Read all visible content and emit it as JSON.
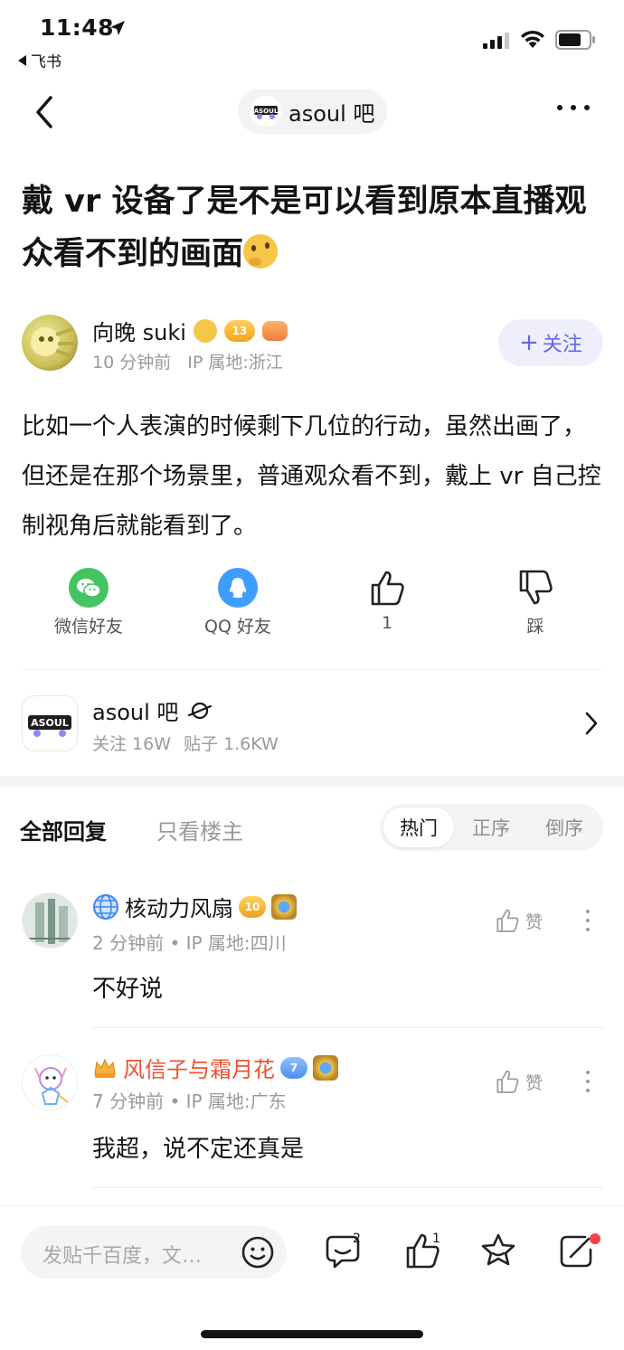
{
  "status_bar": {
    "time": "11:48",
    "back_app": "飞书"
  },
  "nav": {
    "forum_pill": "asoul 吧"
  },
  "post": {
    "title": "戴 vr 设备了是不是可以看到原本直播观众看不到的画面",
    "author": {
      "name": "向晚 suki",
      "level": "13",
      "time": "10 分钟前",
      "ip": "IP 属地:浙江"
    },
    "follow_label": "关注",
    "body": "比如一个人表演的时候剩下几位的行动，虽然出画了，但还是在那个场景里，普通观众看不到，戴上 vr 自己控制视角后就能看到了。"
  },
  "share": {
    "wechat": "微信好友",
    "qq": "QQ 好友",
    "like_count": "1",
    "dislike": "踩"
  },
  "forum": {
    "name": "asoul 吧",
    "followers": "关注 16W",
    "posts": "贴子 1.6KW"
  },
  "replies": {
    "tab_all": "全部回复",
    "tab_op": "只看楼主",
    "sort": [
      "热门",
      "正序",
      "倒序"
    ],
    "comments": [
      {
        "name": "核动力风扇",
        "level": "10",
        "time": "2 分钟前",
        "ip": "IP 属地:四川",
        "text": "不好说",
        "like_label": "赞"
      },
      {
        "name": "风信子与霜月花",
        "level": "7",
        "time": "7 分钟前",
        "ip": "IP 属地:广东",
        "text": "我超，说不定还真是",
        "like_label": "赞"
      }
    ]
  },
  "bottom": {
    "placeholder": "发贴千百度，文…",
    "comment_count": "2",
    "like_count": "1"
  },
  "colors": {
    "accent": "#6168e8",
    "wechat": "#44c463",
    "qq": "#3d9eff",
    "vip_name": "#f0502e",
    "red_dot": "#f5404b"
  }
}
